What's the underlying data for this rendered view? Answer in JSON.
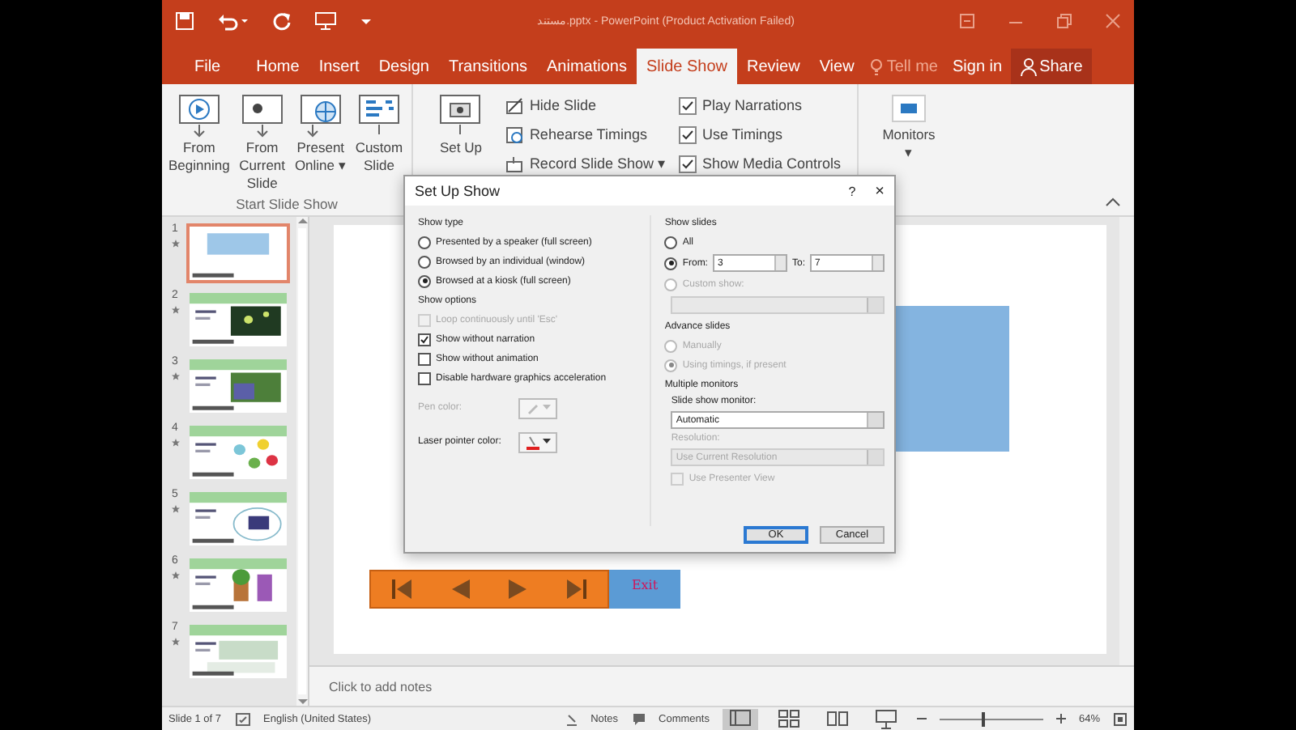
{
  "title_bar": {
    "title": "مستند.pptx - PowerPoint (Product Activation Failed)"
  },
  "tabs": [
    {
      "label": "File",
      "selected": false
    },
    {
      "label": "Home",
      "selected": false
    },
    {
      "label": "Insert",
      "selected": false
    },
    {
      "label": "Design",
      "selected": false
    },
    {
      "label": "Transitions",
      "selected": false
    },
    {
      "label": "Animations",
      "selected": false
    },
    {
      "label": "Slide Show",
      "selected": true
    },
    {
      "label": "Review",
      "selected": false
    },
    {
      "label": "View",
      "selected": false
    }
  ],
  "tell_me": "Tell me",
  "sign_in": "Sign in",
  "share": "Share",
  "ribbon": {
    "start_group": {
      "label": "Start Slide Show",
      "buttons": [
        {
          "kind": "play",
          "label": "From Beginning"
        },
        {
          "kind": "current",
          "label": "From Current Slide"
        },
        {
          "kind": "online",
          "label": "Present Online ▾"
        },
        {
          "kind": "custom",
          "label": "Custom Slide"
        }
      ]
    },
    "setup_group": {
      "setup_button": "Set Up",
      "small_buttons": [
        {
          "kind": "hide",
          "label": "Hide Slide"
        },
        {
          "kind": "rehearse",
          "label": "Rehearse Timings"
        },
        {
          "kind": "record",
          "label": "Record Slide Show ▾"
        }
      ],
      "checks": [
        {
          "label": "Play Narrations",
          "checked": true
        },
        {
          "label": "Use Timings",
          "checked": true
        },
        {
          "label": "Show Media Controls",
          "checked": true
        }
      ]
    },
    "monitors": {
      "label": "Monitors",
      "caret": "▾"
    }
  },
  "thumbnails": [
    {
      "number": "1",
      "selected": true
    },
    {
      "number": "2",
      "selected": false
    },
    {
      "number": "3",
      "selected": false
    },
    {
      "number": "4",
      "selected": false
    },
    {
      "number": "5",
      "selected": false
    },
    {
      "number": "6",
      "selected": false
    },
    {
      "number": "7",
      "selected": false
    }
  ],
  "slide": {
    "exit_label": "Exit"
  },
  "notes_placeholder": "Click to add notes",
  "dialog": {
    "title": "Set Up Show",
    "help": "?",
    "close": "×",
    "show_type": {
      "heading": "Show type",
      "options": [
        {
          "label": "Presented by a speaker (full screen)",
          "selected": false
        },
        {
          "label": "Browsed by an individual (window)",
          "selected": false
        },
        {
          "label": "Browsed at a kiosk (full screen)",
          "selected": true
        }
      ]
    },
    "show_options": {
      "heading": "Show options",
      "checks": [
        {
          "label": "Loop continuously until 'Esc'",
          "checked": false,
          "disabled": true
        },
        {
          "label": "Show without narration",
          "checked": true,
          "disabled": false
        },
        {
          "label": "Show without animation",
          "checked": false,
          "disabled": false
        },
        {
          "label": "Disable hardware graphics acceleration",
          "checked": false,
          "disabled": false
        }
      ],
      "pen_color": {
        "label": "Pen color:",
        "disabled": true
      },
      "laser_color": {
        "label": "Laser pointer color:",
        "disabled": false
      }
    },
    "show_slides": {
      "heading": "Show slides",
      "options": [
        {
          "label": "All",
          "selected": false,
          "disabled": false
        },
        {
          "label": "From:",
          "selected": true,
          "disabled": false
        },
        {
          "label": "Custom show:",
          "selected": false,
          "disabled": true
        }
      ],
      "from_value": "3",
      "to_label": "To:",
      "to_value": "7"
    },
    "advance_slides": {
      "heading": "Advance slides",
      "options": [
        {
          "label": "Manually",
          "selected": false,
          "disabled": true
        },
        {
          "label": "Using timings, if present",
          "selected": true,
          "disabled": true
        }
      ]
    },
    "multiple_monitors": {
      "heading": "Multiple monitors",
      "monitor_label": "Slide show monitor:",
      "monitor_value": "Automatic",
      "resolution_label": "Resolution:",
      "resolution_value": "Use Current Resolution",
      "presenter_view": {
        "label": "Use Presenter View",
        "checked": false,
        "disabled": true
      }
    },
    "buttons": [
      {
        "label": "OK",
        "selected": true
      },
      {
        "label": "Cancel",
        "selected": false
      }
    ]
  },
  "status_bar": {
    "slide_info": "Slide 1 of 7",
    "language": "English (United States)",
    "notes": "Notes",
    "comments": "Comments",
    "views": [
      {
        "kind": "normal",
        "selected": true
      },
      {
        "kind": "sorter",
        "selected": false
      },
      {
        "kind": "reading",
        "selected": false
      },
      {
        "kind": "slideshow",
        "selected": false
      }
    ],
    "zoom": {
      "level": 0.4,
      "value": "64%"
    }
  }
}
